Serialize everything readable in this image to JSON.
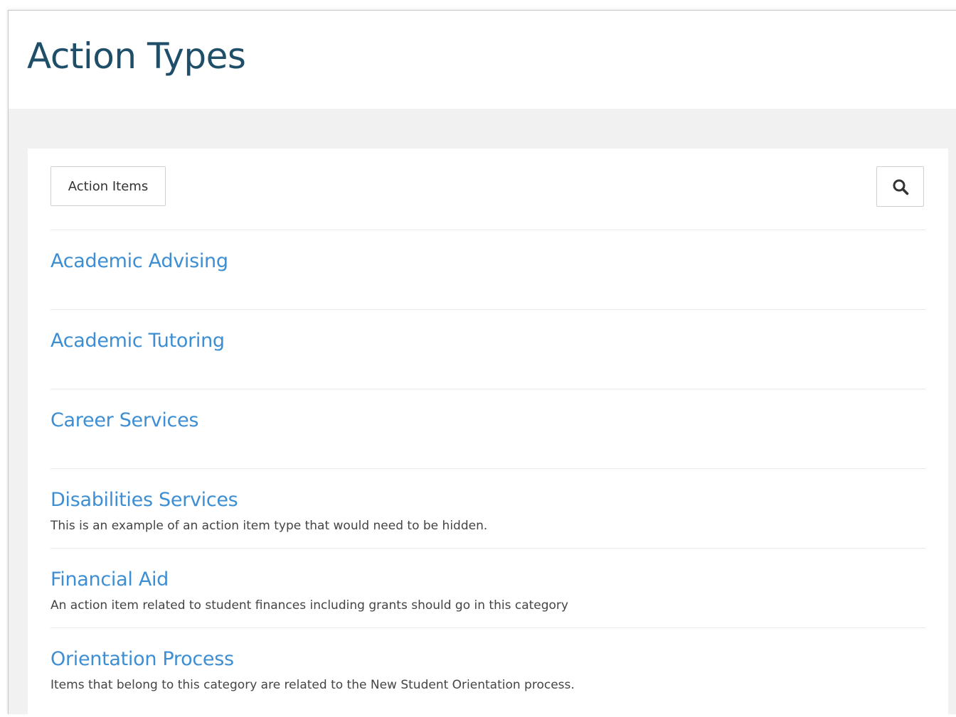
{
  "header": {
    "title": "Action Types"
  },
  "toolbar": {
    "filter_label": "Action Items",
    "search_icon": "search-icon"
  },
  "colors": {
    "title": "#1f4e69",
    "link": "#3d8ed3",
    "background": "#f1f1f1"
  },
  "action_types": [
    {
      "title": "Academic Advising",
      "description": ""
    },
    {
      "title": "Academic Tutoring",
      "description": ""
    },
    {
      "title": "Career Services",
      "description": ""
    },
    {
      "title": "Disabilities Services",
      "description": "This is an example of an action item type that would need to be hidden."
    },
    {
      "title": "Financial Aid",
      "description": "An action item related to student finances including grants should go in this category"
    },
    {
      "title": "Orientation Process",
      "description": "Items that belong to this category are related to the New Student Orientation process."
    }
  ]
}
